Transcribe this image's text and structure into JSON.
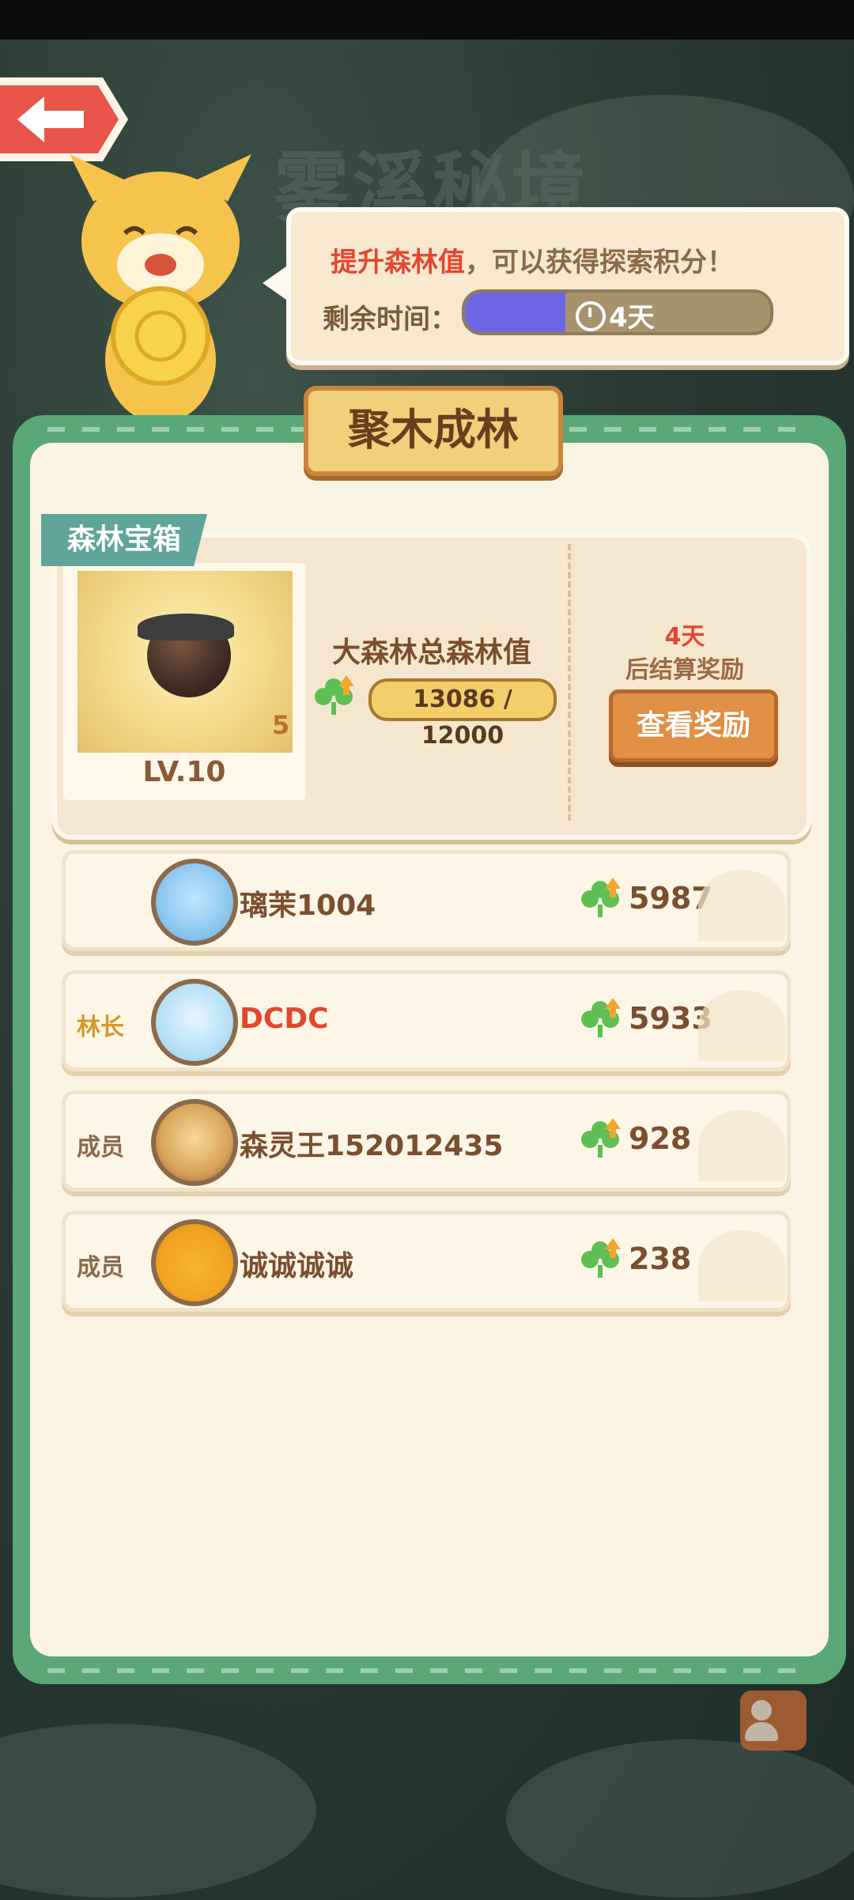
{
  "header": {
    "back_icon": "left-arrow-icon",
    "title": "雾溪秘境"
  },
  "bubble": {
    "highlight": "提升森林值",
    "message_rest": "，可以获得探索积分！",
    "time_label": "剩余时间：",
    "time_value": "4天",
    "time_progress": 0.33,
    "clock_icon": "clock-icon"
  },
  "panel": {
    "title": "聚木成林"
  },
  "chest": {
    "tag": "森林宝箱",
    "count": "5",
    "level": "LV.10",
    "forest_label": "大森林总森林值",
    "forest_value": "13086 / 12000",
    "settle_days": "4天",
    "settle_text": "后结算奖励",
    "reward_button": "查看奖励"
  },
  "members": [
    {
      "role": "",
      "name": "璃茉1004",
      "score": "5987"
    },
    {
      "role": "林长",
      "name": "DCDC",
      "score": "5933"
    },
    {
      "role": "成员",
      "name": "森灵王152012435",
      "score": "928"
    },
    {
      "role": "成员",
      "name": "诚诚诚诚",
      "score": "238"
    }
  ],
  "colors": {
    "accent_green": "#5aa876",
    "highlight_red": "#e3472f",
    "progress_blue": "#6f66e6"
  }
}
